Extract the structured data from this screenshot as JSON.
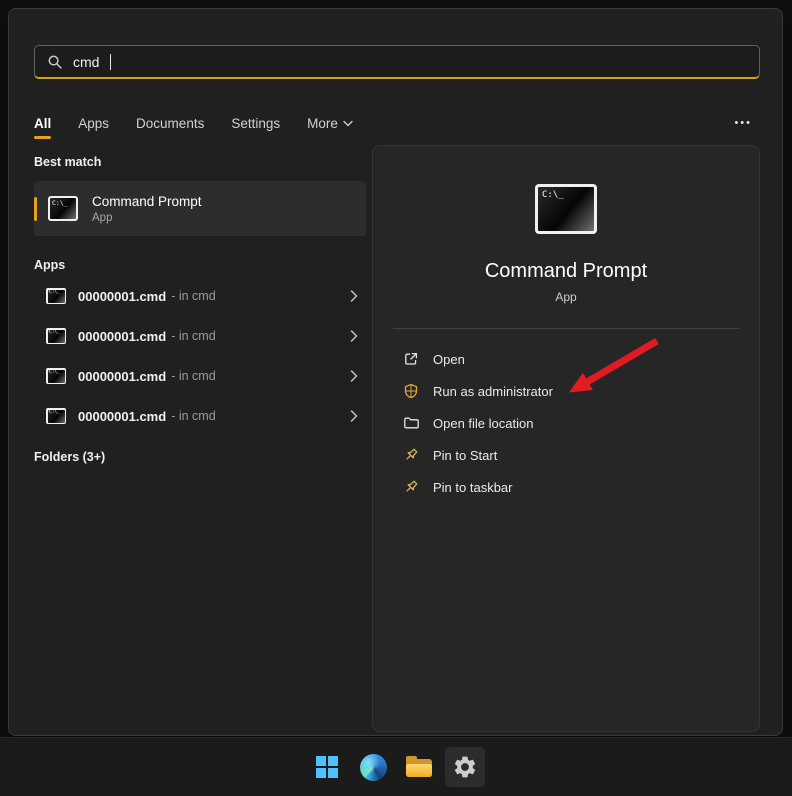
{
  "search": {
    "value": "cmd"
  },
  "tabs": {
    "active": "All",
    "items": [
      {
        "label": "All"
      },
      {
        "label": "Apps"
      },
      {
        "label": "Documents"
      },
      {
        "label": "Settings"
      },
      {
        "label": "More"
      }
    ]
  },
  "sections": {
    "best_match": {
      "header": "Best match",
      "item": {
        "title": "Command Prompt",
        "subtitle": "App"
      }
    },
    "apps": {
      "header": "Apps",
      "items": [
        {
          "name": "00000001.cmd",
          "context": "- in cmd"
        },
        {
          "name": "00000001.cmd",
          "context": "- in cmd"
        },
        {
          "name": "00000001.cmd",
          "context": "- in cmd"
        },
        {
          "name": "00000001.cmd",
          "context": "- in cmd"
        }
      ]
    },
    "folders": {
      "header": "Folders (3+)"
    }
  },
  "preview": {
    "app_name": "Command Prompt",
    "app_type": "App",
    "actions": [
      {
        "label": "Open",
        "icon": "open-icon"
      },
      {
        "label": "Run as administrator",
        "icon": "admin-shield-icon"
      },
      {
        "label": "Open file location",
        "icon": "folder-icon"
      },
      {
        "label": "Pin to Start",
        "icon": "pin-icon"
      },
      {
        "label": "Pin to taskbar",
        "icon": "pin-icon"
      }
    ]
  },
  "icons": {
    "cmd_glyph": "C:\\_",
    "more_options": "•••"
  },
  "colors": {
    "accent_gold": "#e3a21a",
    "search_underline": "#d9a40a",
    "arrow_red": "#e01b24",
    "panel_bg": "#202020",
    "selection_bg": "#2d2d2d",
    "preview_bg": "#262626",
    "taskbar_bg": "#1b1b1c"
  },
  "taskbar": {
    "buttons": [
      {
        "name": "start"
      },
      {
        "name": "edge"
      },
      {
        "name": "file-explorer"
      },
      {
        "name": "settings"
      }
    ]
  }
}
